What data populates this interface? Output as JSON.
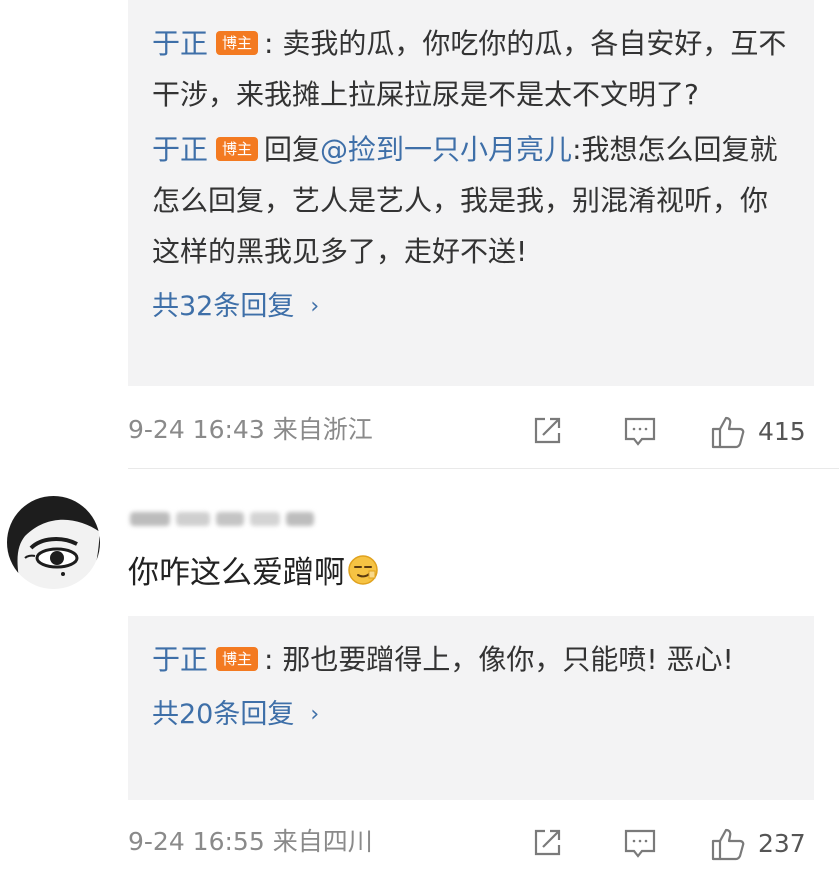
{
  "thread1": {
    "replies": [
      {
        "author": "于正",
        "badge": "博主",
        "sep": ":",
        "text": " 卖我的瓜，你吃你的瓜，各自安好，互不干涉，来我摊上拉屎拉尿是不是太不文明了?"
      },
      {
        "author": "于正",
        "badge": "博主",
        "prefix": "回复",
        "mention": "@捡到一只小月亮儿",
        "text": ":我想怎么回复就怎么回复，艺人是艺人，我是我，别混淆视听，你这样的黑我见多了，走好不送!"
      }
    ],
    "more_label": "共32条回复",
    "more_chevron": "›",
    "date": "9-24 16:43",
    "location": "来自浙江",
    "like_count": "415"
  },
  "comment2": {
    "text": "你咋这么爱蹭啊",
    "emoji": "smirk-emoji",
    "reply": {
      "author": "于正",
      "badge": "博主",
      "sep": ":",
      "text": " 那也要蹭得上，像你，只能喷! 恶心!"
    },
    "more_label": "共20条回复",
    "more_chevron": "›",
    "date": "9-24 16:55",
    "location": "来自四川",
    "like_count": "237"
  },
  "icons": [
    "share-icon",
    "comment-icon",
    "like-icon"
  ],
  "colors": {
    "link": "#3e6fa8",
    "badge": "#f37a21",
    "reply_bg": "#f3f3f4",
    "meta": "#8a8a8a"
  }
}
